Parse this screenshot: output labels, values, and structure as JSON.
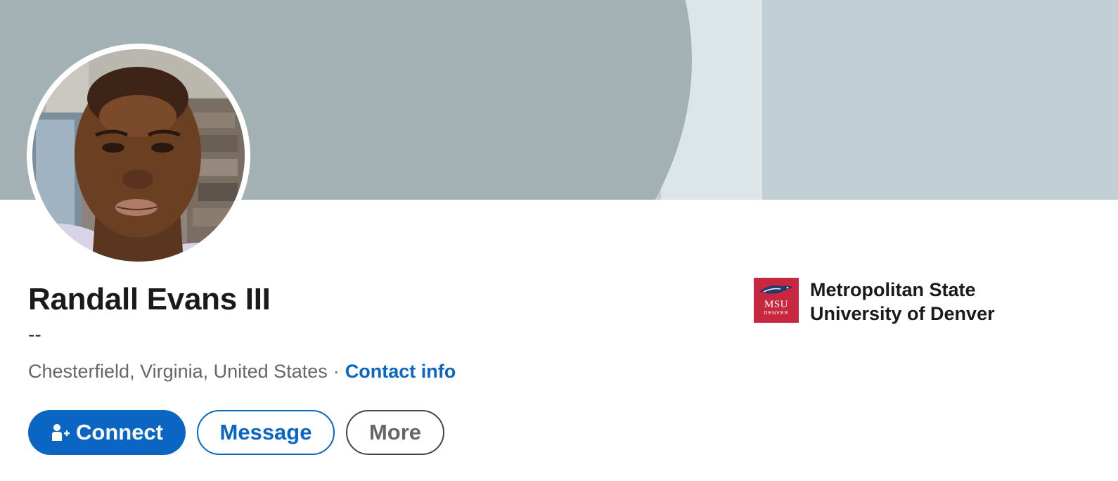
{
  "profile": {
    "name": "Randall Evans III",
    "headline": "--",
    "location": "Chesterfield, Virginia, United States",
    "separator": "·",
    "contact_info_label": "Contact info"
  },
  "actions": {
    "connect_label": "Connect",
    "message_label": "Message",
    "more_label": "More"
  },
  "education": {
    "school_name": "Metropolitan State University of Denver",
    "logo_text": "MSU",
    "logo_subtext": "DENVER"
  },
  "colors": {
    "primary_blue": "#0a66c2",
    "banner_dark": "#a3b1b5",
    "banner_light": "#c2d0d5",
    "school_red": "#c8283f"
  },
  "icons": {
    "connect": "person-add-icon",
    "school_logo": "msu-denver-logo"
  }
}
